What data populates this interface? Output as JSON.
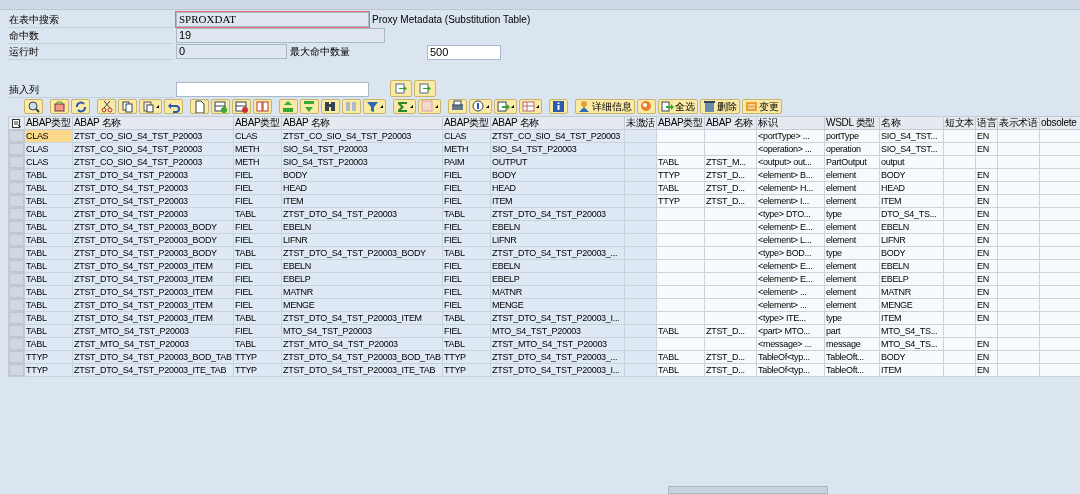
{
  "search": {
    "label": "在表中搜索",
    "value": "SPROXDAT",
    "description": "Proxy Metadata (Substitution Table)"
  },
  "hits": {
    "label": "命中数",
    "value": "19"
  },
  "runtime": {
    "label": "运行时",
    "value": "0",
    "max_label": "最大命中数量",
    "max_value": "500"
  },
  "insert_column": {
    "label": "插入列"
  },
  "toolbar": {
    "text_buttons": [
      "详细信息",
      "全选",
      "删除",
      "变更"
    ]
  },
  "table": {
    "columns": [
      "ABAP类型",
      "ABAP 名称",
      "ABAP类型",
      "ABAP 名称",
      "ABAP类型",
      "ABAP 名称",
      "未激活",
      "ABAP类型",
      "ABAP 名称",
      "标识",
      "WSDL 类型",
      "名称",
      "短文本",
      "语言",
      "表示术语",
      "obsolete"
    ],
    "rows": [
      {
        "focused": true,
        "cells": [
          "CLAS",
          "ZTST_CO_SIO_S4_TST_P20003",
          "CLAS",
          "ZTST_CO_SIO_S4_TST_P20003",
          "CLAS",
          "ZTST_CO_SIO_S4_TST_P20003",
          null,
          null,
          null,
          "<portType> ...",
          "portType",
          "SIO_S4_TST...",
          null,
          "EN",
          null,
          null
        ]
      },
      {
        "focused": false,
        "cells": [
          "CLAS",
          "ZTST_CO_SIO_S4_TST_P20003",
          "METH",
          "SIO_S4_TST_P20003",
          "METH",
          "SIO_S4_TST_P20003",
          null,
          null,
          null,
          "<operation> ...",
          "operation",
          "SIO_S4_TST...",
          null,
          "EN",
          null,
          null
        ]
      },
      {
        "focused": false,
        "cells": [
          "CLAS",
          "ZTST_CO_SIO_S4_TST_P20003",
          "METH",
          "SIO_S4_TST_P20003",
          "PAIM",
          "OUTPUT",
          null,
          "TABL",
          "ZTST_M...",
          "<output> out...",
          "PartOutput",
          "output",
          null,
          null,
          null,
          null
        ]
      },
      {
        "focused": false,
        "cells": [
          "TABL",
          "ZTST_DTO_S4_TST_P20003",
          "FIEL",
          "BODY",
          "FIEL",
          "BODY",
          null,
          "TTYP",
          "ZTST_D...",
          "<element> B...",
          "element",
          "BODY",
          null,
          "EN",
          null,
          null
        ]
      },
      {
        "focused": false,
        "cells": [
          "TABL",
          "ZTST_DTO_S4_TST_P20003",
          "FIEL",
          "HEAD",
          "FIEL",
          "HEAD",
          null,
          "TABL",
          "ZTST_D...",
          "<element> H...",
          "element",
          "HEAD",
          null,
          "EN",
          null,
          null
        ]
      },
      {
        "focused": false,
        "cells": [
          "TABL",
          "ZTST_DTO_S4_TST_P20003",
          "FIEL",
          "ITEM",
          "FIEL",
          "ITEM",
          null,
          "TTYP",
          "ZTST_D...",
          "<element> I...",
          "element",
          "ITEM",
          null,
          "EN",
          null,
          null
        ]
      },
      {
        "focused": false,
        "cells": [
          "TABL",
          "ZTST_DTO_S4_TST_P20003",
          "TABL",
          "ZTST_DTO_S4_TST_P20003",
          "TABL",
          "ZTST_DTO_S4_TST_P20003",
          null,
          null,
          null,
          "<type> DTO...",
          "type",
          "DTO_S4_TS...",
          null,
          "EN",
          null,
          null
        ]
      },
      {
        "focused": false,
        "cells": [
          "TABL",
          "ZTST_DTO_S4_TST_P20003_BODY",
          "FIEL",
          "EBELN",
          "FIEL",
          "EBELN",
          null,
          null,
          null,
          "<element> E...",
          "element",
          "EBELN",
          null,
          "EN",
          null,
          null
        ]
      },
      {
        "focused": false,
        "cells": [
          "TABL",
          "ZTST_DTO_S4_TST_P20003_BODY",
          "FIEL",
          "LIFNR",
          "FIEL",
          "LIFNR",
          null,
          null,
          null,
          "<element> L...",
          "element",
          "LIFNR",
          null,
          "EN",
          null,
          null
        ]
      },
      {
        "focused": false,
        "cells": [
          "TABL",
          "ZTST_DTO_S4_TST_P20003_BODY",
          "TABL",
          "ZTST_DTO_S4_TST_P20003_BODY",
          "TABL",
          "ZTST_DTO_S4_TST_P20003_...",
          null,
          null,
          null,
          "<type> BOD...",
          "type",
          "BODY",
          null,
          "EN",
          null,
          null
        ]
      },
      {
        "focused": false,
        "cells": [
          "TABL",
          "ZTST_DTO_S4_TST_P20003_ITEM",
          "FIEL",
          "EBELN",
          "FIEL",
          "EBELN",
          null,
          null,
          null,
          "<element> E...",
          "element",
          "EBELN",
          null,
          "EN",
          null,
          null
        ]
      },
      {
        "focused": false,
        "cells": [
          "TABL",
          "ZTST_DTO_S4_TST_P20003_ITEM",
          "FIEL",
          "EBELP",
          "FIEL",
          "EBELP",
          null,
          null,
          null,
          "<element> E...",
          "element",
          "EBELP",
          null,
          "EN",
          null,
          null
        ]
      },
      {
        "focused": false,
        "cells": [
          "TABL",
          "ZTST_DTO_S4_TST_P20003_ITEM",
          "FIEL",
          "MATNR",
          "FIEL",
          "MATNR",
          null,
          null,
          null,
          "<element> ...",
          "element",
          "MATNR",
          null,
          "EN",
          null,
          null
        ]
      },
      {
        "focused": false,
        "cells": [
          "TABL",
          "ZTST_DTO_S4_TST_P20003_ITEM",
          "FIEL",
          "MENGE",
          "FIEL",
          "MENGE",
          null,
          null,
          null,
          "<element> ...",
          "element",
          "MENGE",
          null,
          "EN",
          null,
          null
        ]
      },
      {
        "focused": false,
        "cells": [
          "TABL",
          "ZTST_DTO_S4_TST_P20003_ITEM",
          "TABL",
          "ZTST_DTO_S4_TST_P20003_ITEM",
          "TABL",
          "ZTST_DTO_S4_TST_P20003_I...",
          null,
          null,
          null,
          "<type> ITE...",
          "type",
          "ITEM",
          null,
          "EN",
          null,
          null
        ]
      },
      {
        "focused": false,
        "cells": [
          "TABL",
          "ZTST_MTO_S4_TST_P20003",
          "FIEL",
          "MTO_S4_TST_P20003",
          "FIEL",
          "MTO_S4_TST_P20003",
          null,
          "TABL",
          "ZTST_D...",
          "<part> MTO...",
          "part",
          "MTO_S4_TS...",
          null,
          null,
          null,
          null
        ]
      },
      {
        "focused": false,
        "cells": [
          "TABL",
          "ZTST_MTO_S4_TST_P20003",
          "TABL",
          "ZTST_MTO_S4_TST_P20003",
          "TABL",
          "ZTST_MTO_S4_TST_P20003",
          null,
          null,
          null,
          "<message> ...",
          "message",
          "MTO_S4_TS...",
          null,
          "EN",
          null,
          null
        ]
      },
      {
        "focused": false,
        "cells": [
          "TTYP",
          "ZTST_DTO_S4_TST_P20003_BOD_TAB",
          "TTYP",
          "ZTST_DTO_S4_TST_P20003_BOD_TAB",
          "TTYP",
          "ZTST_DTO_S4_TST_P20003_...",
          null,
          "TABL",
          "ZTST_D...",
          "TableOf<typ...",
          "TableOft...",
          "BODY",
          null,
          "EN",
          null,
          null
        ]
      },
      {
        "focused": false,
        "cells": [
          "TTYP",
          "ZTST_DTO_S4_TST_P20003_ITE_TAB",
          "TTYP",
          "ZTST_DTO_S4_TST_P20003_ITE_TAB",
          "TTYP",
          "ZTST_DTO_S4_TST_P20003_I...",
          null,
          "TABL",
          "ZTST_D...",
          "TableOf<typ...",
          "TableOft...",
          "ITEM",
          null,
          "EN",
          null,
          null
        ]
      }
    ]
  }
}
